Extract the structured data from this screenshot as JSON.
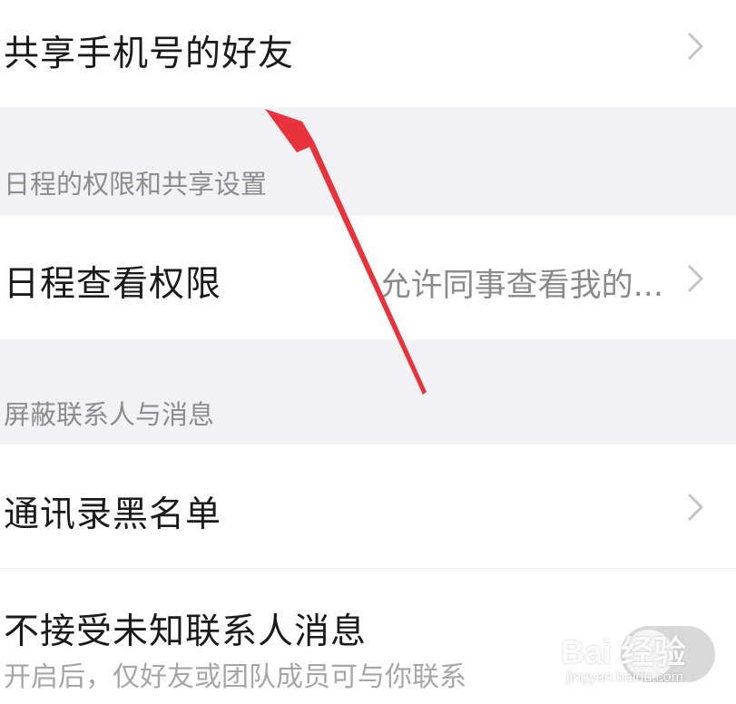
{
  "rows": {
    "share_phone_friends": {
      "title": "共享手机号的好友"
    },
    "schedule_view_permission": {
      "title": "日程查看权限",
      "value": "允许同事查看我的..."
    },
    "contacts_blacklist": {
      "title": "通讯录黑名单"
    },
    "reject_unknown": {
      "title": "不接受未知联系人消息",
      "subtitle": "开启后，仅好友或团队成员可与你联系",
      "toggle_on": false
    }
  },
  "sections": {
    "schedule": "日程的权限和共享设置",
    "block": "屏蔽联系人与消息"
  },
  "watermark": {
    "logo": "Bai 经验",
    "sub": "jingyan.baidu.com"
  },
  "colors": {
    "section_bg": "#f2f2f4",
    "annotation_arrow": "#e8323c",
    "toggle_off": "#d9d9d9"
  }
}
